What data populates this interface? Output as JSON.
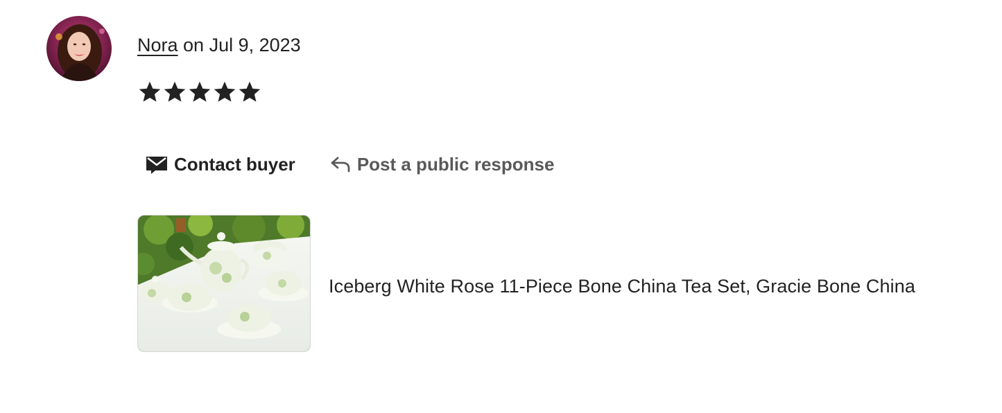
{
  "review": {
    "author": "Nora",
    "date_text": " on Jul 9, 2023",
    "rating": 5,
    "rating_max": 5
  },
  "actions": {
    "contact_label": "Contact buyer",
    "contact_icon": "envelope-icon",
    "respond_label": "Post a public response",
    "respond_icon": "reply-arrow-icon"
  },
  "listing": {
    "title": "Iceberg White Rose 11-Piece Bone China Tea Set, Gracie Bone China"
  },
  "colors": {
    "text": "#222222",
    "muted": "#595959",
    "star": "#222222"
  }
}
